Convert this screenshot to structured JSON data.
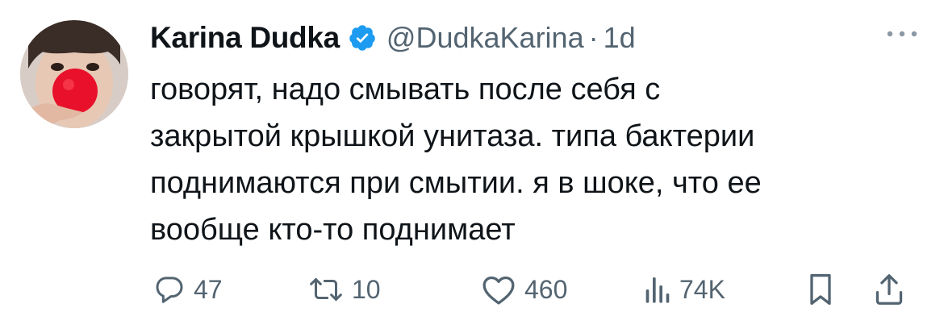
{
  "author": {
    "display_name": "Karina Dudka",
    "handle": "@DudkaKarina",
    "separator": "·",
    "time": "1d",
    "verified": true
  },
  "tweet": {
    "text": "говорят, надо смывать после себя с\nзакрытой крышкой унитаза. типа бактерии\nподнимаются при смытии. я в шоке, что ее\nвообще кто-то поднимает"
  },
  "actions": {
    "replies": "47",
    "retweets": "10",
    "likes": "460",
    "views": "74K"
  },
  "icons": {
    "verified": "verified-badge-icon",
    "more": "more-dots-icon",
    "reply": "reply-bubble-icon",
    "retweet": "retweet-icon",
    "like": "heart-icon",
    "views": "views-bars-icon",
    "bookmark": "bookmark-icon",
    "share": "share-icon"
  },
  "colors": {
    "text": "#0f1419",
    "secondary": "#536471",
    "verified": "#1d9bf0",
    "background": "#ffffff"
  }
}
